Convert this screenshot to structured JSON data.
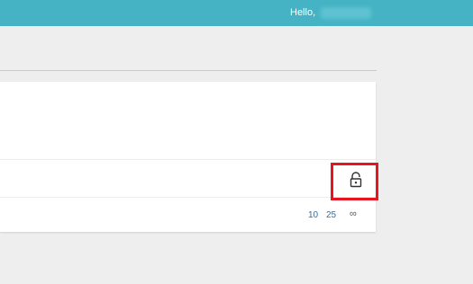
{
  "header": {
    "greeting": "Hello,",
    "background_color": "#45b3c4"
  },
  "table": {
    "lock_icon": "unlocked-padlock-icon",
    "highlight_color": "#e8141f"
  },
  "pagination": {
    "options": [
      "10",
      "25",
      "∞"
    ],
    "link_color": "#2f6ea8"
  }
}
